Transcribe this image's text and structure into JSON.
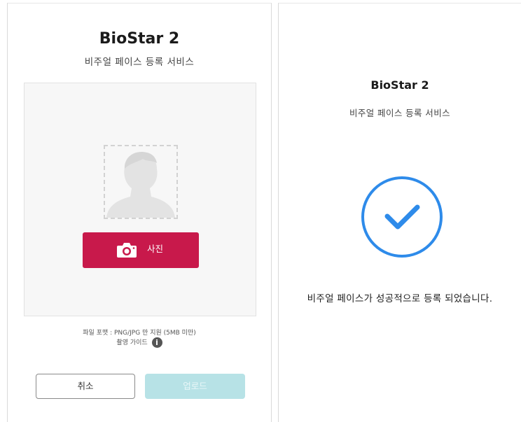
{
  "left_panel": {
    "brand": "BioStar 2",
    "subtitle": "비주얼 페이스 등록 서비스",
    "photo_button_label": "사진",
    "file_format_note": "파일 포맷 : PNG/JPG 만 지원 (5MB 미만)",
    "guide_label": "촬영 가이드",
    "cancel_label": "취소",
    "upload_label": "업로드"
  },
  "right_panel": {
    "brand": "BioStar 2",
    "subtitle": "비주얼 페이스 등록 서비스",
    "success_message": "비주얼 페이스가 성공적으로 등록 되었습니다."
  },
  "colors": {
    "primary_red": "#c8194b",
    "upload_disabled": "#b7e2e6",
    "check_blue": "#2e8bea"
  },
  "icons": [
    "camera-icon",
    "info-icon",
    "person-silhouette-icon",
    "check-circle-icon"
  ]
}
